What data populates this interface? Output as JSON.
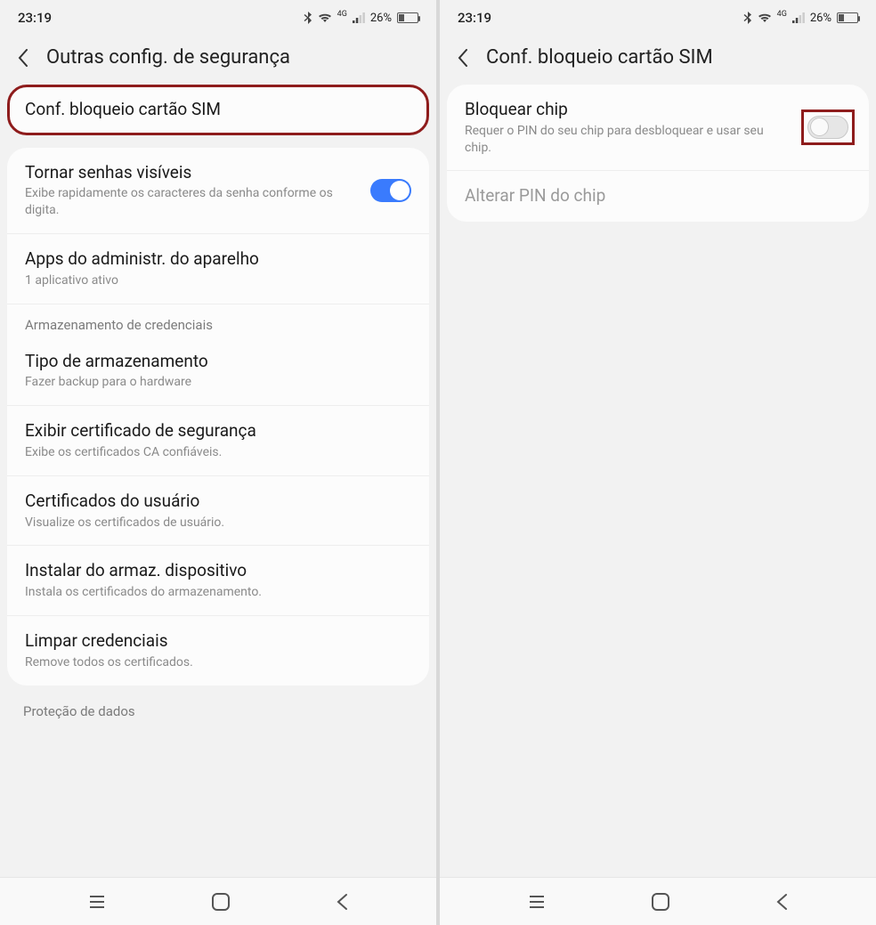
{
  "status": {
    "time": "23:19",
    "network_label": "4G",
    "battery_percent": "26%"
  },
  "left": {
    "header_title": "Outras config. de segurança",
    "row_sim": "Conf. bloqueio cartão SIM",
    "row_passwords_title": "Tornar senhas visíveis",
    "row_passwords_sub": "Exibe rapidamente os caracteres da senha conforme os digita.",
    "row_admin_title": "Apps do administr. do aparelho",
    "row_admin_sub": "1 aplicativo ativo",
    "section_credentials": "Armazenamento de credenciais",
    "row_storage_title": "Tipo de armazenamento",
    "row_storage_sub": "Fazer backup para o hardware",
    "row_cert_title": "Exibir certificado de segurança",
    "row_cert_sub": "Exibe os certificados CA confiáveis.",
    "row_usercert_title": "Certificados do usuário",
    "row_usercert_sub": "Visualize os certificados de usuário.",
    "row_install_title": "Instalar do armaz. dispositivo",
    "row_install_sub": "Instala os certificados do armazenamento.",
    "row_clear_title": "Limpar credenciais",
    "row_clear_sub": "Remove todos os certificados.",
    "section_dataprotect": "Proteção de dados"
  },
  "right": {
    "header_title": "Conf. bloqueio cartão SIM",
    "row_lock_title": "Bloquear chip",
    "row_lock_sub": "Requer o PIN do seu chip para desbloquear e usar seu chip.",
    "row_changepin": "Alterar PIN do chip"
  }
}
